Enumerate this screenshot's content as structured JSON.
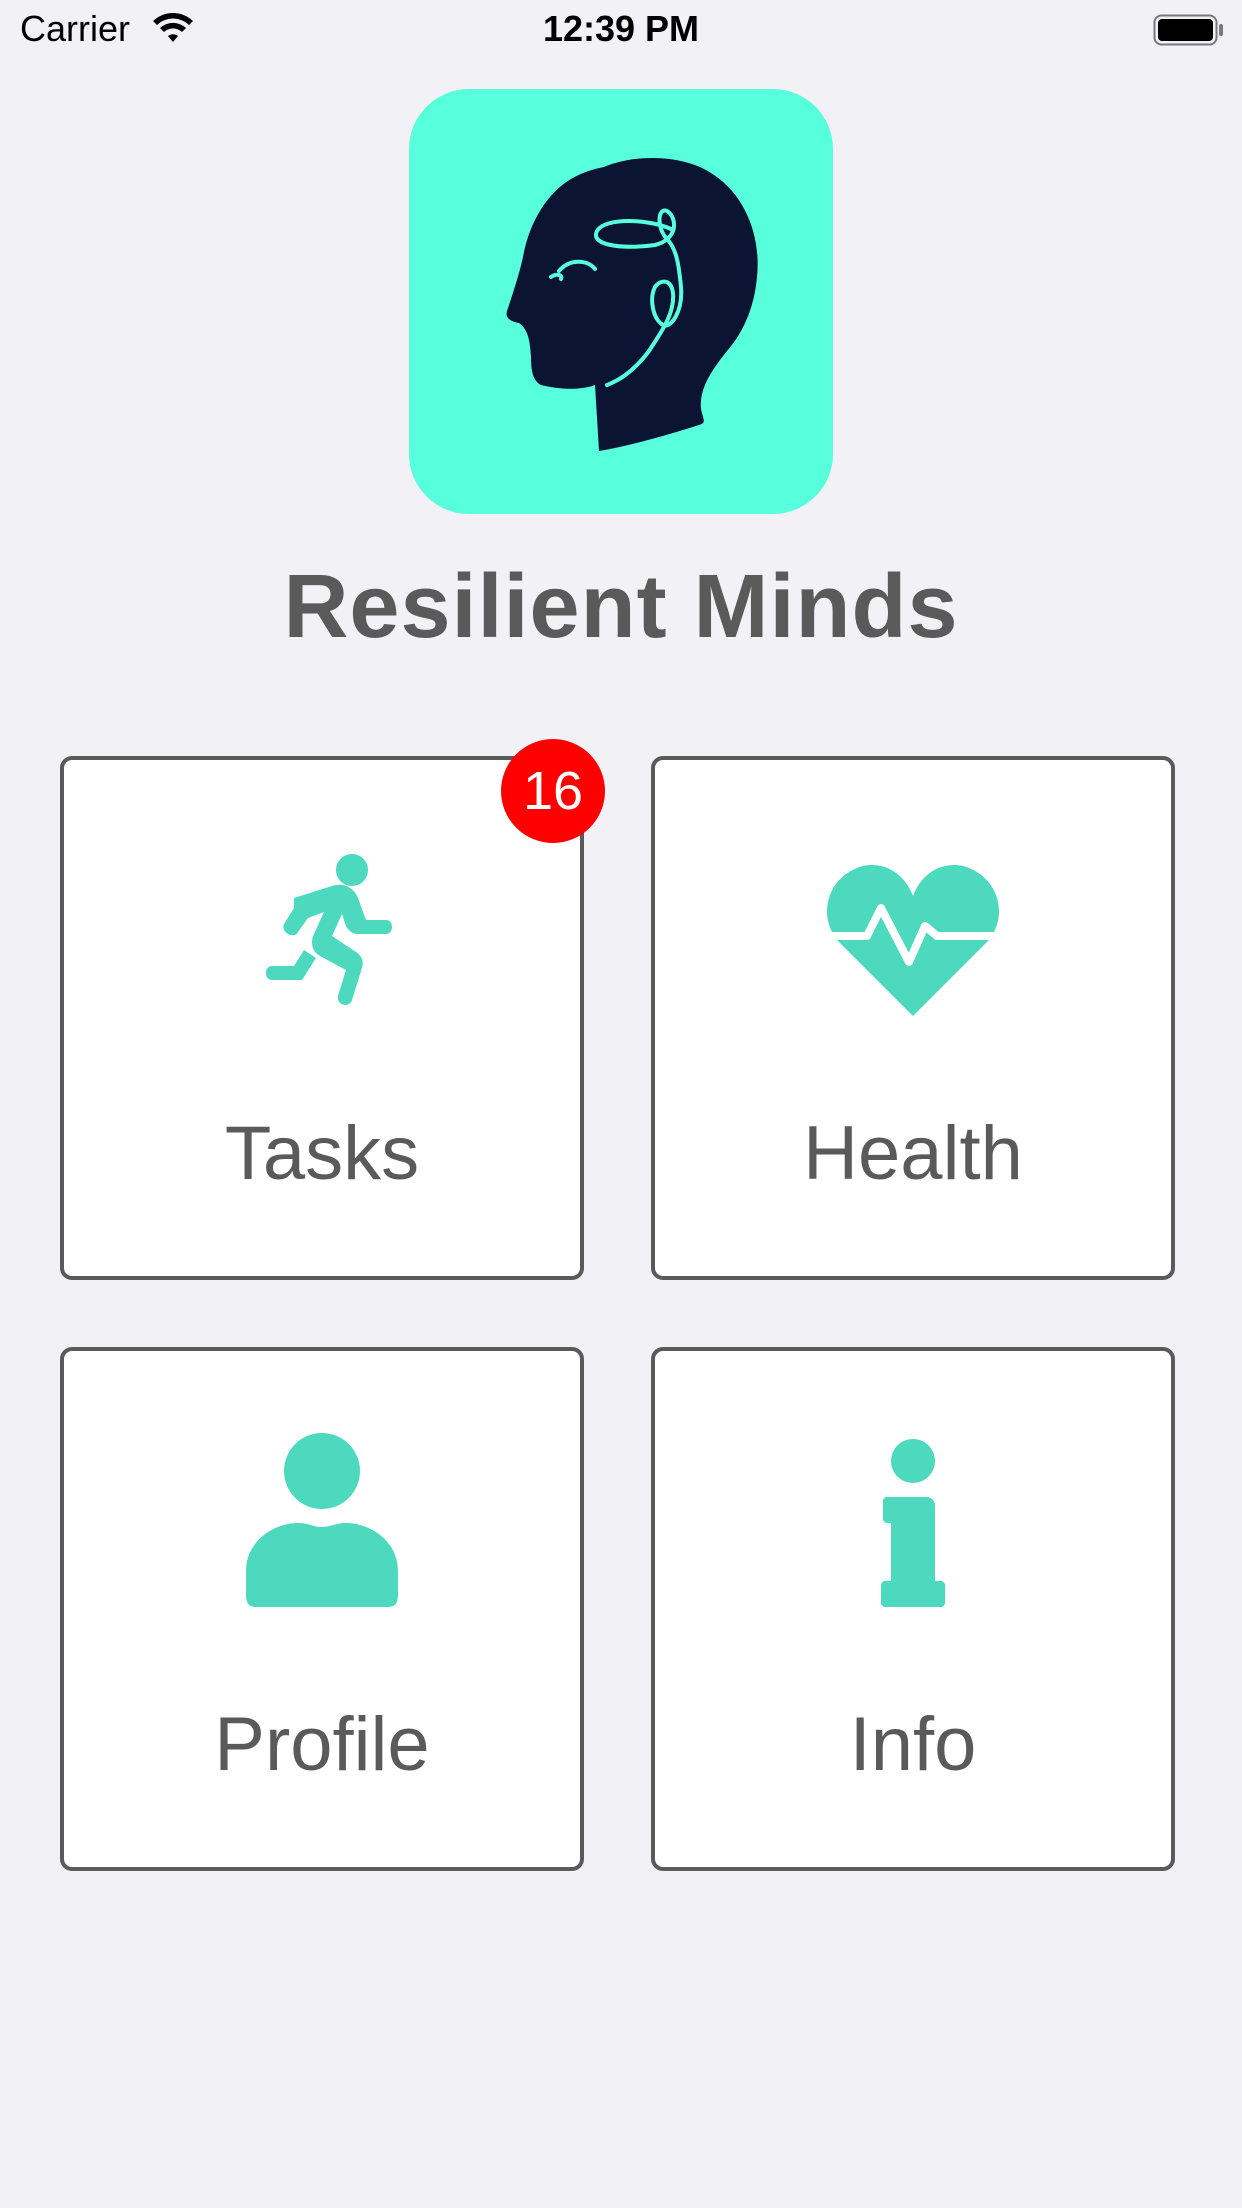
{
  "status_bar": {
    "carrier": "Carrier",
    "time": "12:39 PM",
    "wifi_icon": "wifi-icon",
    "battery_icon": "battery-icon"
  },
  "app": {
    "name": "Resilient Minds",
    "logo_icon": "head-profile-logo",
    "logo_color": "#58ffdd",
    "logo_ink": "#0b1433"
  },
  "colors": {
    "accent": "#4dd9bd",
    "text": "#5a5a5a",
    "badge": "#ff0000",
    "background": "#f2f1f6"
  },
  "tiles": [
    {
      "label": "Tasks",
      "icon": "running-person-icon",
      "badge": "16"
    },
    {
      "label": "Health",
      "icon": "heart-pulse-icon"
    },
    {
      "label": "Profile",
      "icon": "person-icon"
    },
    {
      "label": "Info",
      "icon": "info-icon"
    }
  ]
}
